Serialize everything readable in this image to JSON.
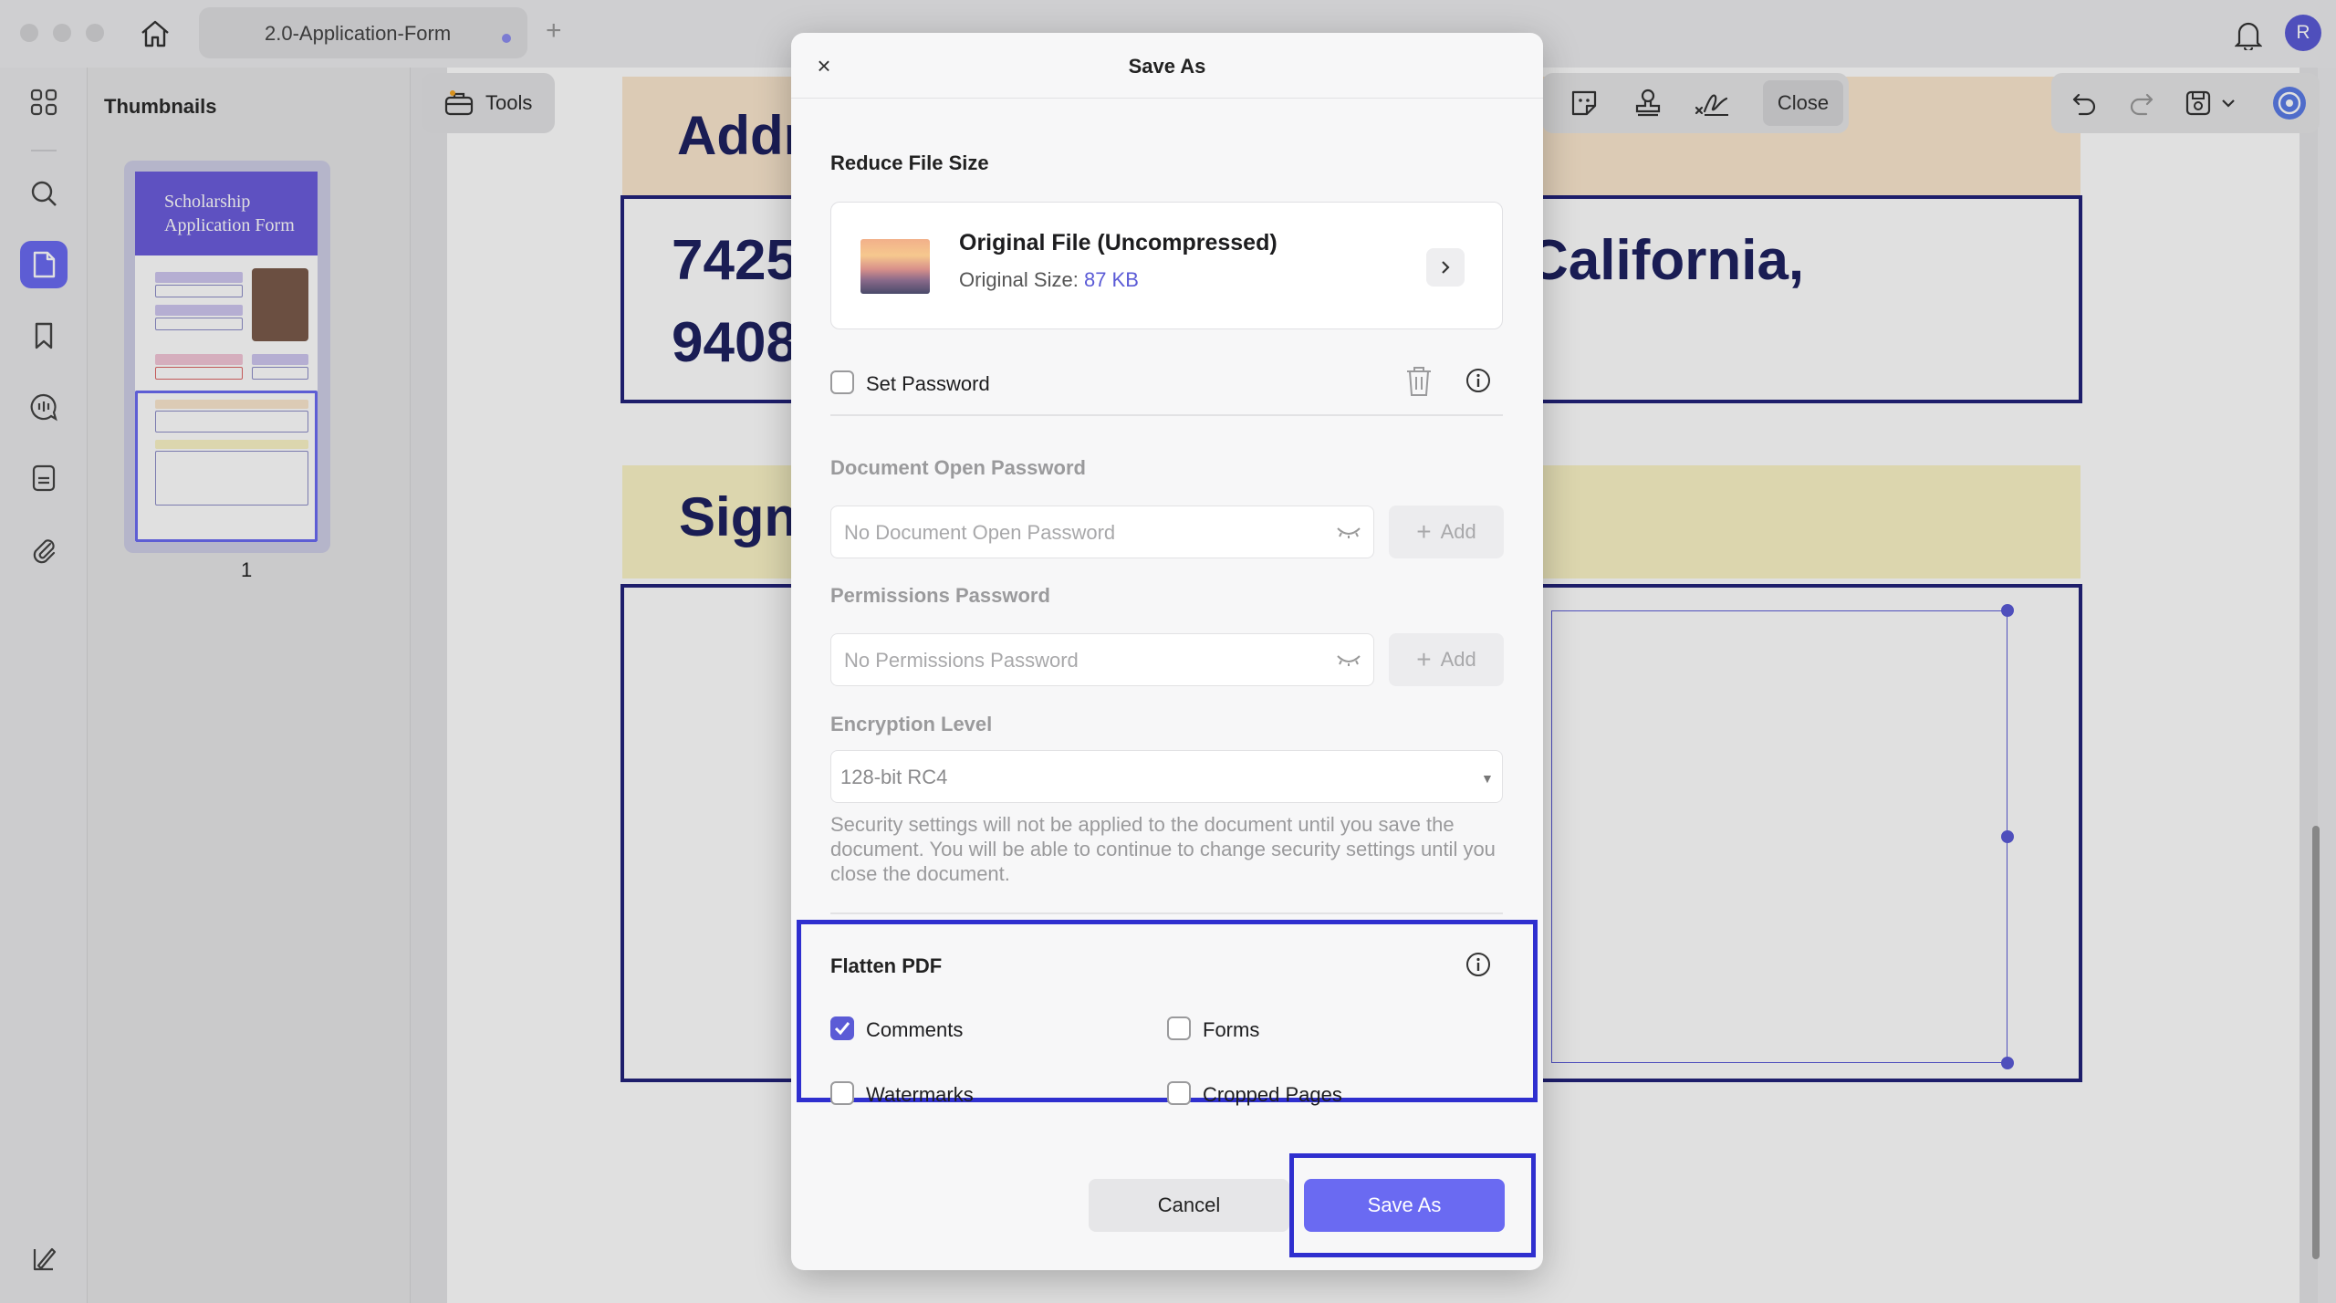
{
  "window": {
    "tab_title": "2.0-Application-Form",
    "new_tab": "+",
    "avatar_initial": "R"
  },
  "sidebar": {
    "icons": [
      "grid-icon",
      "search-icon",
      "pages-icon",
      "bookmark-icon",
      "comments-icon",
      "document-icon",
      "attachment-icon"
    ],
    "bottom_icon": "layers-icon"
  },
  "thumbnails": {
    "title": "Thumbnails",
    "page_number": "1",
    "thumb_title_line1": "Scholarship",
    "thumb_title_line2": "Application Form"
  },
  "toolbar": {
    "tools_label": "Tools",
    "close_label": "Close"
  },
  "document": {
    "address_heading": "Addr",
    "address_line1": "7425",
    "address_line2": "9408",
    "address_line1_right": "California,",
    "signature_heading": "Sign"
  },
  "dialog": {
    "title": "Save As",
    "close_symbol": "×",
    "reduce_label": "Reduce File Size",
    "file": {
      "title": "Original File (Uncompressed)",
      "size_label": "Original Size:",
      "size_value": "87 KB"
    },
    "set_password_label": "Set Password",
    "set_password_checked": false,
    "open_password": {
      "label": "Document Open Password",
      "placeholder": "No Document Open Password",
      "add_label": "Add"
    },
    "permissions_password": {
      "label": "Permissions Password",
      "placeholder": "No Permissions Password",
      "add_label": "Add"
    },
    "encryption": {
      "label": "Encryption Level",
      "value": "128-bit RC4"
    },
    "security_note": "Security settings will not be applied to the document until you save the document. You will be able to continue to change security settings until you close the document.",
    "flatten": {
      "label": "Flatten PDF",
      "options": [
        {
          "label": "Comments",
          "checked": true
        },
        {
          "label": "Forms",
          "checked": false
        },
        {
          "label": "Watermarks",
          "checked": false
        },
        {
          "label": "Cropped Pages",
          "checked": false
        }
      ]
    },
    "cancel_label": "Cancel",
    "save_label": "Save As"
  },
  "colors": {
    "accent": "#6a6af2",
    "highlight": "#2f2fcf",
    "doc_navy": "#1e2160"
  }
}
